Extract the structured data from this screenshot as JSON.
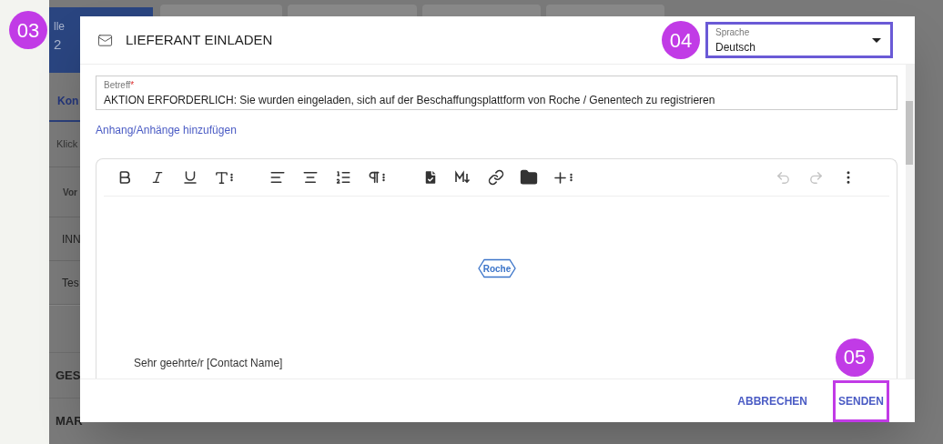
{
  "background": {
    "tile": [
      "lle",
      "2"
    ],
    "tab": "Kon",
    "hint": "Klick",
    "table_header": "Vor",
    "rows": [
      "INN",
      "Tes"
    ],
    "sections": [
      "GES",
      "MAR"
    ]
  },
  "page_badge": "03",
  "dialog": {
    "title": "LIEFERANT EINLADEN",
    "language": {
      "label": "Sprache",
      "value": "Deutsch",
      "badge": "04",
      "highlighted": true
    },
    "subject": {
      "label": "Betreff",
      "required_mark": "*",
      "value": "AKTION ERFORDERLICH: Sie wurden eingeladen, sich auf der Beschaffungsplattform von Roche / Genentech zu registrieren"
    },
    "attach_link": "Anhang/Anhänge hinzufügen",
    "editor": {
      "logo_text": "Roche",
      "body": "Sehr geehrte/r [Contact Name]",
      "toolbar": [
        {
          "kind": "bold",
          "disabled": false
        },
        {
          "kind": "italic",
          "disabled": false
        },
        {
          "kind": "underline",
          "disabled": false
        },
        {
          "kind": "font-size",
          "disabled": false
        },
        {
          "kind": "gap"
        },
        {
          "kind": "align",
          "disabled": false
        },
        {
          "kind": "align-center",
          "disabled": false
        },
        {
          "kind": "list",
          "disabled": false
        },
        {
          "kind": "paragraph",
          "disabled": false
        },
        {
          "kind": "gap"
        },
        {
          "kind": "template",
          "disabled": false
        },
        {
          "kind": "markdown",
          "disabled": false
        },
        {
          "kind": "link",
          "disabled": false
        },
        {
          "kind": "folder",
          "disabled": false
        },
        {
          "kind": "insert",
          "disabled": false
        },
        {
          "kind": "spacer"
        },
        {
          "kind": "undo",
          "disabled": true
        },
        {
          "kind": "redo",
          "disabled": true
        },
        {
          "kind": "more",
          "disabled": false
        }
      ]
    },
    "buttons": [
      {
        "label": "ABBRECHEN",
        "highlighted": false
      },
      {
        "label": "SENDEN",
        "highlighted": true,
        "badge": "05"
      }
    ]
  }
}
